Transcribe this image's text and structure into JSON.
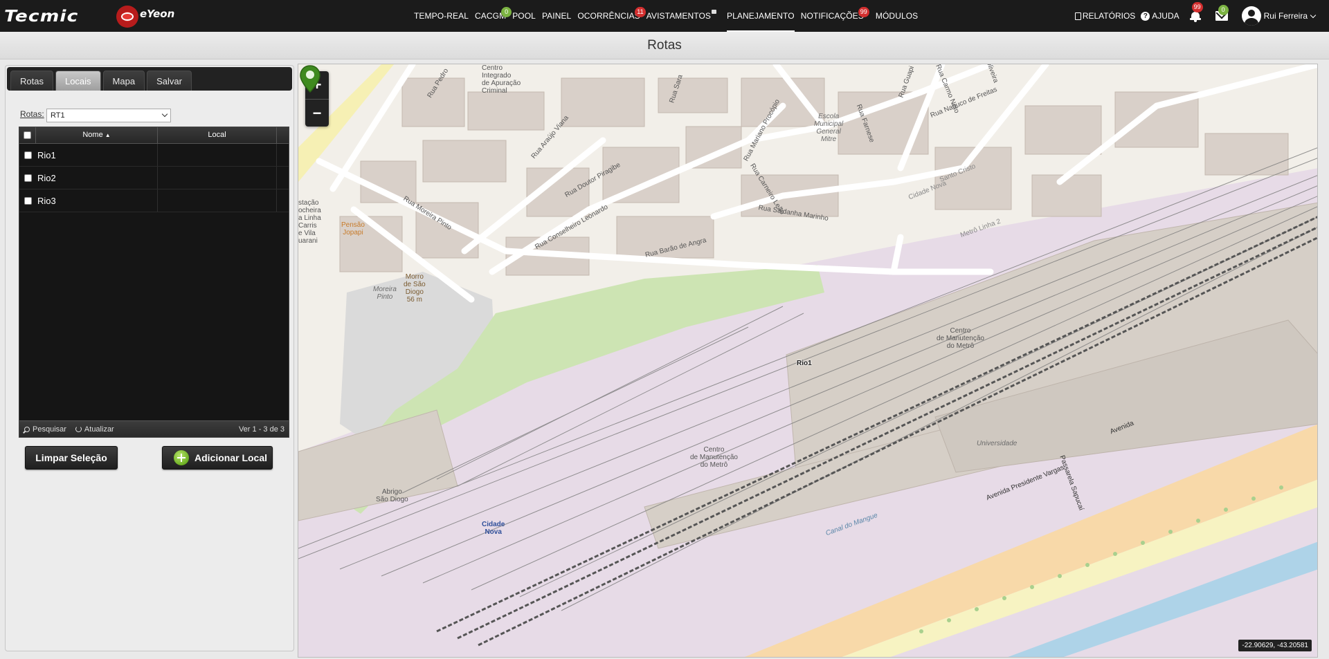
{
  "brand": {
    "logo": "Tecmic",
    "product": "eYeon"
  },
  "nav": [
    {
      "label": "TEMPO-REAL"
    },
    {
      "label": "CACGM",
      "badge": "0",
      "badge_color": "#7cb342"
    },
    {
      "label": "POOL"
    },
    {
      "label": "PAINEL"
    },
    {
      "label": "OCORRÊNCIAS",
      "badge": "11",
      "badge_color": "#d32f2f"
    },
    {
      "label": "AVISTAMENTOS"
    },
    {
      "label": "PLANEJAMENTO",
      "active": true
    },
    {
      "label": "NOTIFICAÇÕES",
      "badge": "99",
      "badge_color": "#d32f2f"
    },
    {
      "label": "MÓDULOS"
    }
  ],
  "right_nav": {
    "reports": "RELATÓRIOS",
    "help": "AJUDA",
    "notifications_badge": "99",
    "messages_badge": "0",
    "user": "Rui Ferreira"
  },
  "page": {
    "title": "Rotas"
  },
  "tabs": [
    {
      "label": "Rotas"
    },
    {
      "label": "Locais",
      "active": true
    },
    {
      "label": "Mapa"
    },
    {
      "label": "Salvar"
    }
  ],
  "route_select": {
    "label": "Rotas:",
    "value": "RT1"
  },
  "grid": {
    "columns": {
      "name": "Nome",
      "local": "Local"
    },
    "rows": [
      {
        "name": "Rio1",
        "local": ""
      },
      {
        "name": "Rio2",
        "local": ""
      },
      {
        "name": "Rio3",
        "local": ""
      }
    ],
    "footer": {
      "search": "Pesquisar",
      "refresh": "Atualizar",
      "count": "Ver 1 - 3 de 3"
    }
  },
  "buttons": {
    "clear": "Limpar Seleção",
    "add": "Adicionar Local"
  },
  "map": {
    "zoom_in": "+",
    "zoom_out": "−",
    "marker_label": "Rio1",
    "coords": "-22.90629, -43.20581",
    "labels": {
      "rua_pedro": "Rua Pedro",
      "centro_integrado": "Centro\nIntegrado\nde Apuração\nCriminal",
      "rua_araujo_viana": "Rua Araújo Viana",
      "rua_doutor_piragibe": "Rua Doutor Piragibe",
      "rua_moreira_pinto": "Rua Moreira Pinto",
      "rua_conselheiro_leonardo": "Rua Conselheiro Leonardo",
      "rua_barao_de_angra": "Rua Barão de Angra",
      "rua_saldanha_marinho": "Rua Saldanha Marinho",
      "rua_carneiro_leao": "Rua Carneiro Leão",
      "rua_mariano_procopio": "Rua Mariano Procópio",
      "rua_sara": "Rua Sara",
      "rua_guapi": "Rua Guapi",
      "rua_carmo_neto": "Rua Carmo Neto",
      "rua_nabuco_de_freitas": "Rua Nabuco de Freitas",
      "oliveira": "Oliveira",
      "rua_farnese": "Rua Farnese",
      "escola": "Escola\nMunicipal\nGeneral\nMitre",
      "pensao": "Pensão\nJopapi",
      "morro": "Morro\nde São\nDiogo\n56 m",
      "moreira_pinto": "Moreira\nPinto",
      "estacao": "stação\nocheira\na Linha\nCarris\ne Vila\nuarani",
      "metro_linha_2": "Metrô Linha 2",
      "cidade_nova": "Cidade Nova",
      "santo_cristo": "Santo Cristo",
      "centro_manutencao_1": "Centro\nde Manutenção\ndo Metrô",
      "centro_manutencao_2": "Centro\nde Manutenção\ndo Metrô",
      "universidade": "Universidade",
      "abrigo": "Abrigo\nSão Diogo",
      "avenida_presidente_vargas": "Avenida Presidente Vargas",
      "avenida": "Avenida",
      "passarela": "Passarela Sapucaí",
      "cidade_nova_station": "Cidade\nNova",
      "canal_mangue": "Canal do Mangue"
    }
  }
}
